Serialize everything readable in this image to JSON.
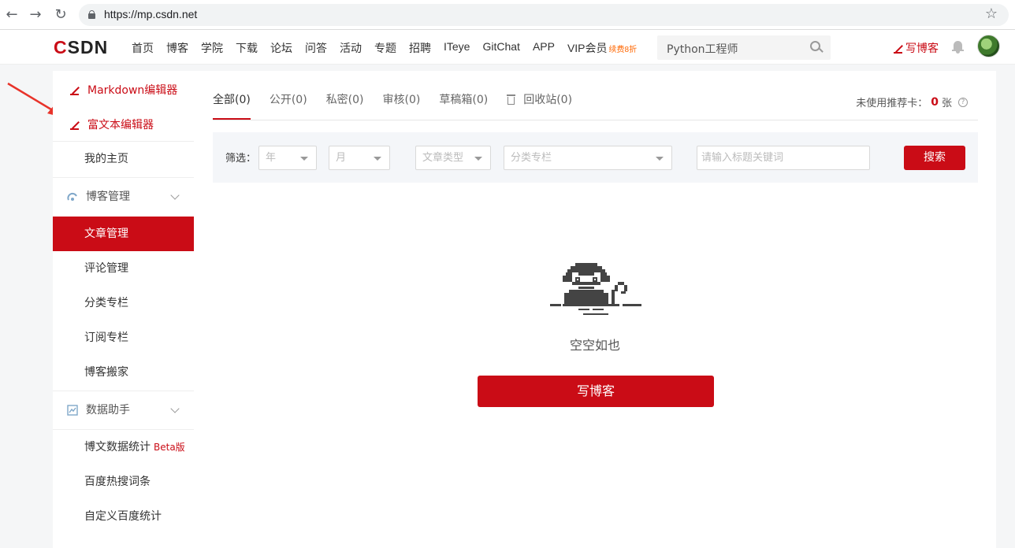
{
  "browser": {
    "url": "https://mp.csdn.net"
  },
  "topnav": {
    "logo": "CSDN",
    "items": [
      "首页",
      "博客",
      "学院",
      "下载",
      "论坛",
      "问答",
      "活动",
      "专题",
      "招聘",
      "ITeye",
      "GitChat",
      "APP",
      "VIP会员"
    ],
    "vip_badge": "续费8折",
    "search_placeholder": "Python工程师",
    "write_blog": "写博客"
  },
  "sidebar": {
    "markdown_editor": "Markdown编辑器",
    "richtext_editor": "富文本编辑器",
    "my_home": "我的主页",
    "blog_management": {
      "title": "博客管理",
      "items": [
        "文章管理",
        "评论管理",
        "分类专栏",
        "订阅专栏",
        "博客搬家"
      ],
      "active": "文章管理"
    },
    "data_assistant": {
      "title": "数据助手",
      "items": [
        "博文数据统计",
        "百度热搜词条",
        "自定义百度统计"
      ],
      "beta": "Beta版"
    }
  },
  "main": {
    "tabs": [
      {
        "label": "全部(0)",
        "active": true
      },
      {
        "label": "公开(0)",
        "active": false
      },
      {
        "label": "私密(0)",
        "active": false
      },
      {
        "label": "审核(0)",
        "active": false
      },
      {
        "label": "草稿箱(0)",
        "active": false
      },
      {
        "label": "回收站(0)",
        "active": false,
        "icon": "trash-icon"
      }
    ],
    "card_count": {
      "label": "未使用推荐卡：",
      "value": "0",
      "unit": "张"
    },
    "filter": {
      "label": "筛选：",
      "year": "年",
      "month": "月",
      "article_type": "文章类型",
      "category": "分类专栏",
      "keyword_placeholder": "请输入标题关键词",
      "search_button": "搜索"
    },
    "empty_text": "空空如也",
    "write_button": "写博客"
  },
  "colors": {
    "brand_red": "#ca0c16"
  }
}
